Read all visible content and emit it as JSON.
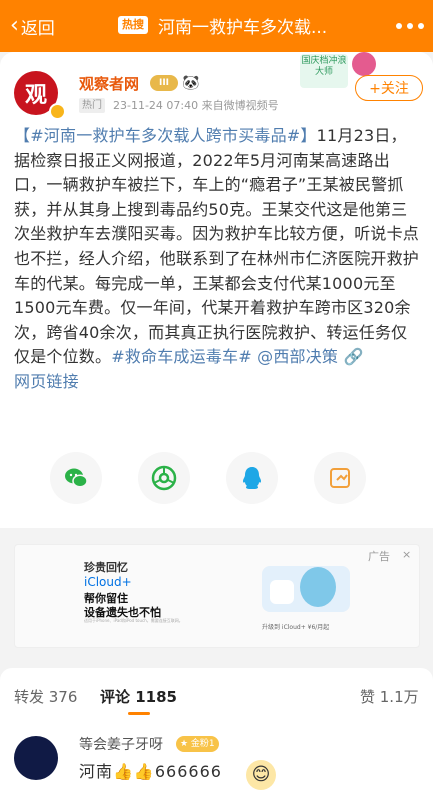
{
  "header": {
    "back_label": "返回",
    "hot_badge": "热搜",
    "title": "河南一救护车多次载..."
  },
  "post": {
    "author": "观察者网",
    "avatar_text": "观",
    "level_badge": "III",
    "hot_tag": "热门",
    "meta": "23-11-24 07:40  来自微博视频号",
    "event_banner": "国庆档冲浪大师",
    "follow_label": "+关注",
    "body_tag": "【#河南一救护车多次载人跨市买毒品#】",
    "body_text": "11月23日，据检察日报正义网报道，2022年5月河南某高速路出口，一辆救护车被拦下，车上的“瘾君子”王某被民警抓获，并从其身上搜到毒品约50克。王某交代这是他第三次坐救护车去濮阳买毒。因为救护车比较方便，听说卡点也不拦，经人介绍，他联系到了在林州市仁济医院开救护车的代某。每完成一单，王某都会支付代某1000元至1500元车费。仅一年间，代某开着救护车跨市区320余次，跨省40余次，而其真正执行医院救护、转运任务仅仅是个位数。",
    "topic2": "#救命车成运毒车#",
    "mention": "@西部决策",
    "link_label": "网页链接"
  },
  "share": [
    "wechat-icon",
    "moments-icon",
    "qq-icon",
    "share-out-icon"
  ],
  "ad": {
    "apple_logo": "",
    "title": "珍贵回忆",
    "product": "iCloud+",
    "line1": "帮你留住",
    "line2": "设备遗失也不怕",
    "fine_print": "适用于iPhone、iPad和iPod touch，需要连接互联网。",
    "cta": "升级到 iCloud+ ¥6/月起",
    "label": "广告",
    "close": "×"
  },
  "tabs": {
    "repost": "转发 376",
    "comments": "评论 1185",
    "likes": "赞 1.1万"
  },
  "comment": {
    "author": "等会姜子牙呀",
    "fan_badge": "★ 金粉1",
    "text": "河南👍👍666666"
  },
  "colors": {
    "brand": "#ff8200",
    "link": "#507daf"
  }
}
